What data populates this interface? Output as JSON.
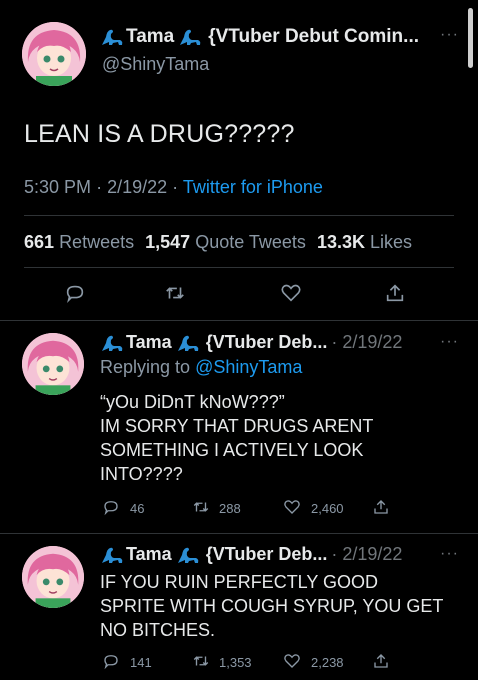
{
  "main_tweet": {
    "display_name": "Tama",
    "name_suffix": "{VTuber Debut Comin...",
    "handle": "@ShinyTama",
    "text": "LEAN IS A DRUG?????",
    "time": "5:30 PM",
    "date": "2/19/22",
    "source": "Twitter for iPhone",
    "retweets_count": "661",
    "retweets_label": "Retweets",
    "quote_count": "1,547",
    "quote_label": "Quote Tweets",
    "likes_count": "13.3K",
    "likes_label": "Likes"
  },
  "reply1": {
    "display_name": "Tama",
    "name_suffix": "{VTuber Deb...",
    "date": "· 2/19/22",
    "replying_prefix": "Replying to",
    "replying_handle": "@ShinyTama",
    "line1": "“yOu DiDnT kNoW???”",
    "line2": "IM SORRY THAT DRUGS ARENT",
    "line3": "SOMETHING I ACTIVELY LOOK",
    "line4": "INTO????",
    "replies": "46",
    "retweets": "288",
    "likes": "2,460"
  },
  "reply2": {
    "display_name": "Tama",
    "name_suffix": "{VTuber Deb...",
    "date": "· 2/19/22",
    "line1": "IF YOU RUIN PERFECTLY GOOD",
    "line2": "SPRITE WITH COUGH SYRUP, YOU GET",
    "line3": "NO BITCHES.",
    "replies": "141",
    "retweets": "1,353",
    "likes": "2,238"
  },
  "icons": {
    "name_decoration": "dinosaur-icon",
    "actions": [
      "reply-icon",
      "retweet-icon",
      "like-icon",
      "share-icon"
    ]
  },
  "colors": {
    "background": "#000000",
    "text": "#e7e9ea",
    "muted": "#8b98a5",
    "link": "#1d9bf0"
  }
}
